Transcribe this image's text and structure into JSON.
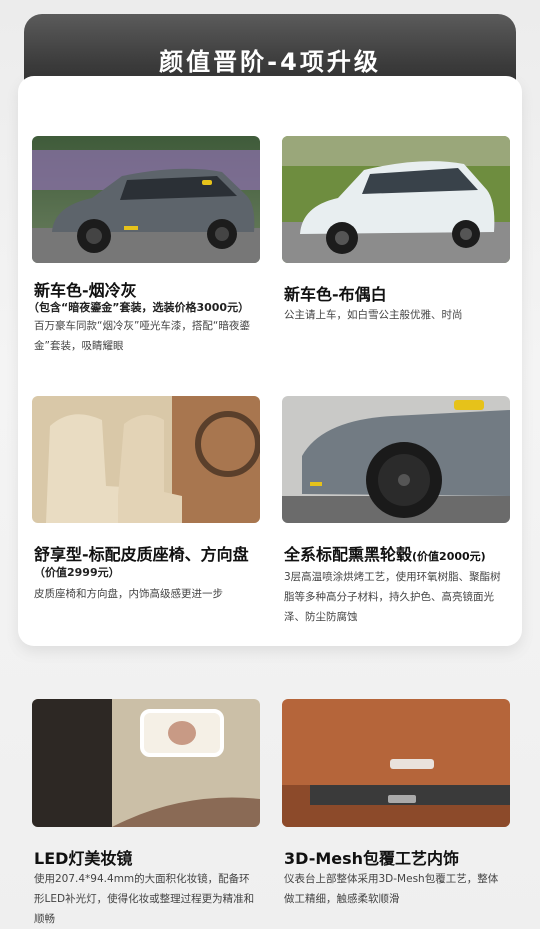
{
  "header": {
    "title": "颜值晋阶-4项升级"
  },
  "items": [
    {
      "title": "新车色-烟冷灰",
      "subtitle": "（包含“暗夜鎏金”套装，选装价格3000元）",
      "desc": "百万豪车同款“烟冷灰”哑光车漆，搭配“暗夜鎏金”套装，吸睛耀眼",
      "image": "gray-car-photo"
    },
    {
      "title": "新车色-布偶白",
      "desc": "公主请上车，如白雪公主般优雅、时尚",
      "image": "white-car-photo"
    },
    {
      "title": "舒享型-标配皮质座椅、方向盘",
      "subtitle": "（价值2999元）",
      "desc": "皮质座椅和方向盘，内饰高级感更进一步",
      "image": "leather-seat-photo"
    },
    {
      "title": "全系标配熏黑轮毂",
      "title_note": "(价值2000元)",
      "desc": "3层高温喷涂烘烤工艺，使用环氧树脂、聚酯树脂等多种高分子材料，持久护色、高亮镜面光泽、防尘防腐蚀",
      "image": "black-wheel-photo"
    },
    {
      "title": "LED灯美妆镜",
      "desc": "使用207.4*94.4mm的大面积化妆镜，配备环形LED补光灯，使得化妆或整理过程更为精准和顺畅",
      "image": "vanity-mirror-photo"
    },
    {
      "title": "3D-Mesh包覆工艺内饰",
      "desc": "仪表台上部整体采用3D-Mesh包覆工艺，整体做工精细，触感柔软顺滑",
      "image": "dashboard-photo"
    }
  ],
  "colors": {
    "banner_dark": "#2a2a2a",
    "accent_yellow": "#e6c21a",
    "card_bg": "#ffffff",
    "page_bg": "#eeeeee"
  }
}
